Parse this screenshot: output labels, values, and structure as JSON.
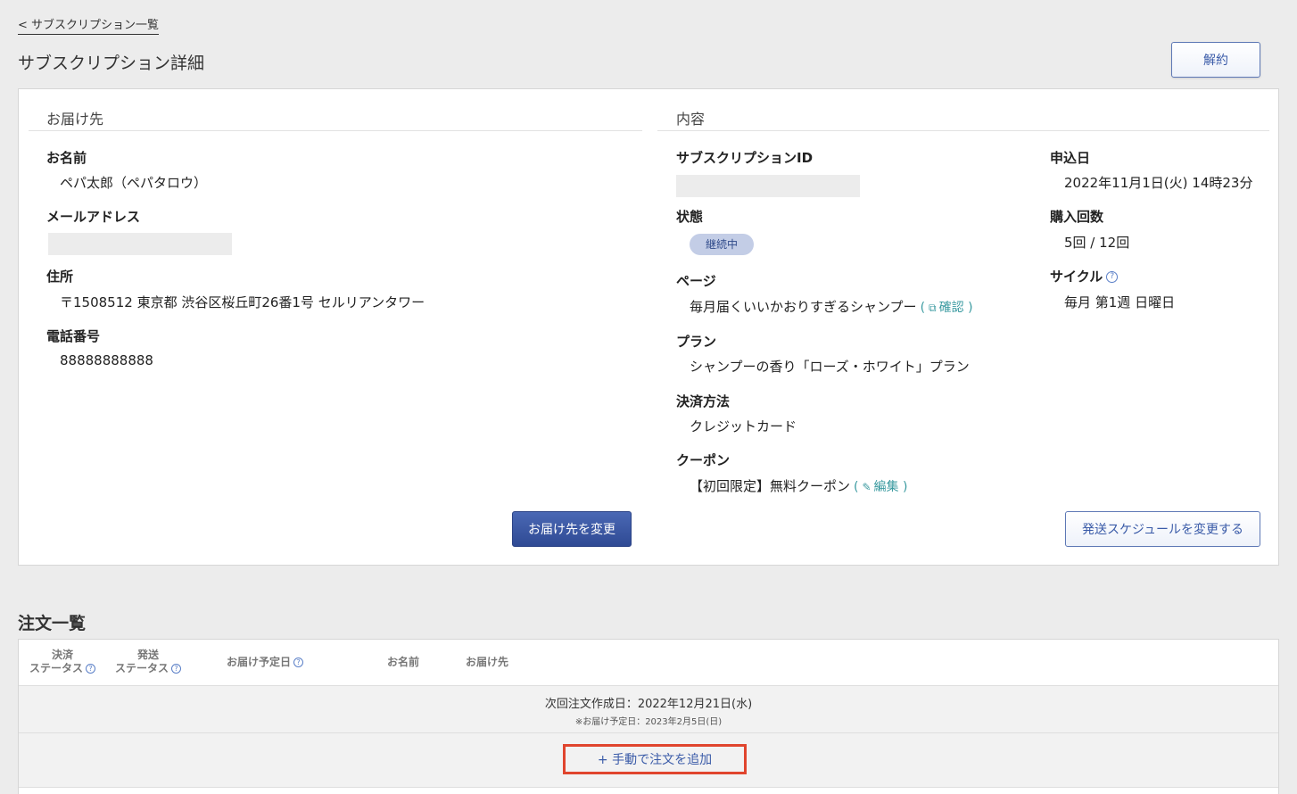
{
  "nav": {
    "back_link": "< サブスクリプション一覧"
  },
  "header": {
    "title": "サブスクリプション詳細",
    "cancel_label": "解約"
  },
  "delivery": {
    "heading": "お届け先",
    "name_label": "お名前",
    "name_value": "ペパ太郎（ペパタロウ）",
    "email_label": "メールアドレス",
    "address_label": "住所",
    "address_value": "〒1508512 東京都 渋谷区桜丘町26番1号 セルリアンタワー",
    "phone_label": "電話番号",
    "phone_value": "88888888888",
    "change_button": "お届け先を変更"
  },
  "content": {
    "heading": "内容",
    "sub_id_label": "サブスクリプションID",
    "status_label": "状態",
    "status_value": "継続中",
    "page_label": "ページ",
    "page_value": "毎月届くいいかおりすぎるシャンプー",
    "page_link": "確認",
    "plan_label": "プラン",
    "plan_value": "シャンプーの香り「ローズ・ホワイト」プラン",
    "payment_label": "決済方法",
    "payment_value": "クレジットカード",
    "coupon_label": "クーポン",
    "coupon_value": "【初回限定】無料クーポン",
    "coupon_link": "編集",
    "applied_label": "申込日",
    "applied_value": "2022年11月1日(火) 14時23分",
    "count_label": "購入回数",
    "count_value": "5回 / 12回",
    "cycle_label": "サイクル",
    "cycle_value": "毎月 第1週 日曜日",
    "schedule_button": "発送スケジュールを変更する"
  },
  "orders": {
    "title": "注文一覧",
    "columns": {
      "payment_status_1": "決済",
      "payment_status_2": "ステータス",
      "shipping_status_1": "発送",
      "shipping_status_2": "ステータス",
      "delivery_date": "お届け予定日",
      "name": "お名前",
      "destination": "お届け先"
    },
    "next_order_date": "次回注文作成日：2022年12月21日(水)",
    "next_delivery_note": "※お届け予定日：2023年2月5日(日)",
    "add_order": "+ 手動で注文を追加"
  },
  "icons": {
    "help": "help-icon",
    "external": "external-link-icon",
    "edit": "pencil-icon"
  },
  "colors": {
    "primary": "#2f4a94",
    "accent_link": "#3a9aa0",
    "highlight": "#e0452e"
  }
}
